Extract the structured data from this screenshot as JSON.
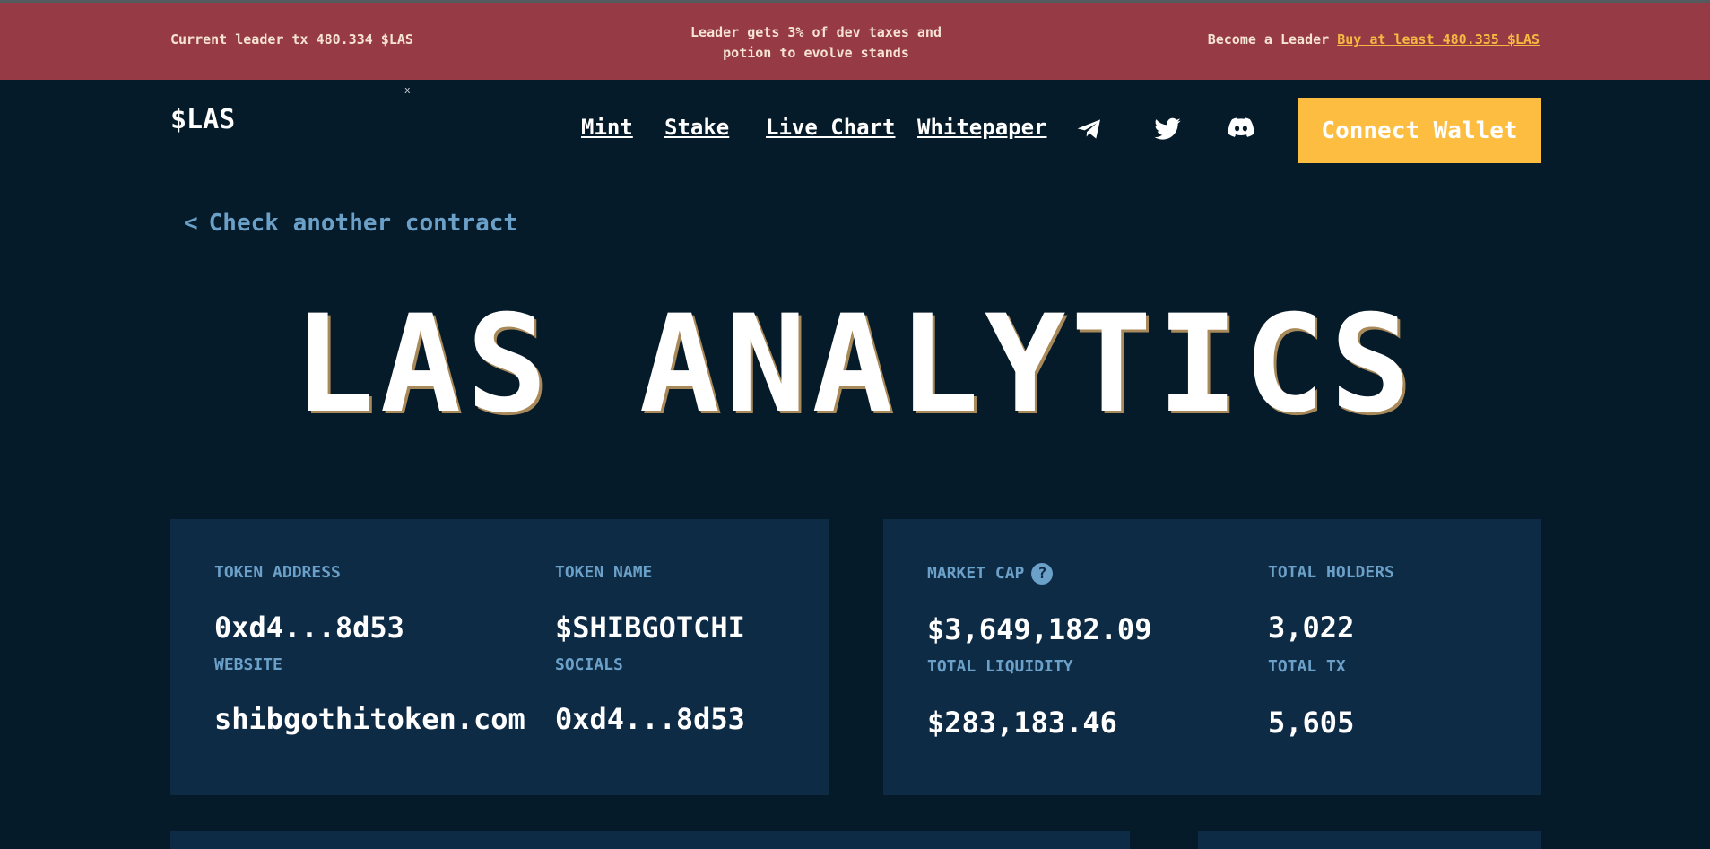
{
  "banner": {
    "current_leader": "Current leader tx 480.334 $LAS",
    "leader_info": "Leader gets 3% of dev taxes and potion to evolve stands",
    "become_leader": "Become a Leader",
    "buy_link": "Buy at least 480.335 $LAS"
  },
  "stray_mark": "x",
  "header": {
    "logo": "$LAS",
    "nav": [
      "Mint",
      "Stake",
      "Live Chart",
      "Whitepaper"
    ],
    "icons": [
      "telegram-icon",
      "twitter-icon",
      "discord-icon"
    ],
    "connect_wallet": "Connect Wallet"
  },
  "back": {
    "chevron": "<",
    "label": "Check another contract"
  },
  "hero": {
    "title": "LAS ANALYTICS"
  },
  "token_card": {
    "token_address_label": "TOKEN ADDRESS",
    "token_address": "0xd4...8d53",
    "token_name_label": "TOKEN NAME",
    "token_name": "$SHIBGOTCHI",
    "website_label": "WEBSITE",
    "website": "shibgothitoken.com",
    "socials_label": "SOCIALS",
    "socials": "0xd4...8d53"
  },
  "stats_card": {
    "market_cap_label": "MARKET CAP",
    "help_glyph": "?",
    "market_cap": "$3,649,182.09",
    "total_holders_label": "TOTAL HOLDERS",
    "total_holders": "3,022",
    "total_liquidity_label": "TOTAL LIQUIDITY",
    "total_liquidity": "$283,183.46",
    "total_tx_label": "TOTAL TX",
    "total_tx": "5,605"
  },
  "colors": {
    "background": "#061b29",
    "banner": "#963a46",
    "card": "#0e2b46",
    "accent": "#fdbd41",
    "label": "#6ba0c8"
  }
}
